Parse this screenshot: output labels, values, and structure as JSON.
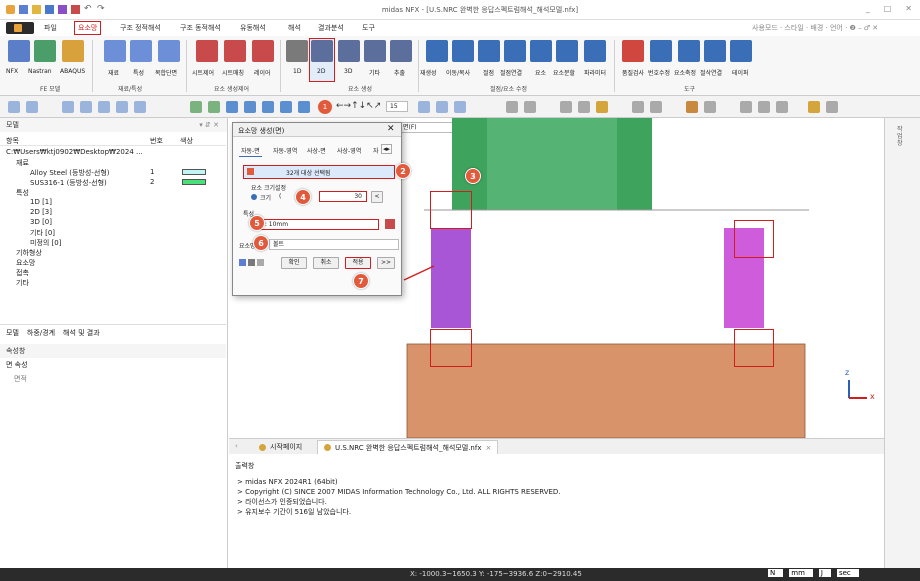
{
  "window": {
    "title": "midas NFX - [U.S.NRC 완벽한 응답스펙트럼해석_해석모델.nfx]",
    "controls": [
      "_",
      "□",
      "✕"
    ]
  },
  "menu": {
    "items": [
      "파일",
      "요소망",
      "구조 정적해석",
      "구조 동적해석",
      "유동해석",
      "해석",
      "결과분석",
      "도구"
    ],
    "active_index": 1,
    "right": "사용모드 · 스타일 · 배경 · 언어 · ❷ – ♂ ✕"
  },
  "ribbon": {
    "buttons": [
      "NFX",
      "Nastran",
      "ABAQUS",
      "재료",
      "특성",
      "복합단면",
      "시트제어",
      "시트매칭",
      "레이어",
      "1D",
      "2D",
      "3D",
      "기타",
      "추출",
      "재생성",
      "이동/복사",
      "절점",
      "절점연결",
      "요소",
      "요소분할",
      "파라미터",
      "품질검사",
      "번호수정",
      "요소축정",
      "절삭연결",
      "테이퍼"
    ],
    "groups": [
      "FE 모델",
      "재료/특성",
      "요소 생성제어",
      "요소 생성",
      "절점/요소 수정",
      "도구"
    ]
  },
  "toolbar2": {
    "zoom_value": "15"
  },
  "left_panel": {
    "model_header": "모델",
    "tree_columns": [
      "항목",
      "번호",
      "색상"
    ],
    "tree": [
      {
        "label": "C:₩Users₩ktj0902₩Desktop₩2024 ...",
        "indent": 0
      },
      {
        "label": "재료",
        "indent": 1
      },
      {
        "label": "Alloy Steel (등방성-선형)",
        "num": "1",
        "indent": 2,
        "color": "#bff5f5"
      },
      {
        "label": "SUS316-1 (등방성-선형)",
        "num": "2",
        "indent": 2,
        "color": "#49e07a"
      },
      {
        "label": "특성",
        "indent": 1
      },
      {
        "label": "1D [1]",
        "indent": 2
      },
      {
        "label": "2D [3]",
        "indent": 2
      },
      {
        "label": "3D [0]",
        "indent": 2
      },
      {
        "label": "기타 [0]",
        "indent": 2
      },
      {
        "label": "미정의 [0]",
        "indent": 2
      },
      {
        "label": "기하형상",
        "indent": 1
      },
      {
        "label": "요소망",
        "indent": 1
      },
      {
        "label": "접촉",
        "indent": 1
      },
      {
        "label": "기타",
        "indent": 1
      }
    ],
    "tabs": [
      "모델",
      "하중/경계",
      "해석 및 결과"
    ],
    "props_header": "속성창",
    "props_section": "면 속성",
    "props_row": "면적"
  },
  "dialog": {
    "title": "요소망 생성(면)",
    "tabs": [
      "자동-면",
      "자동-영역",
      "사상-면",
      "사상-영역",
      "자"
    ],
    "selection": "32개 대상 선택됨",
    "size_label": "요소 크기설정",
    "size_option": "크기",
    "size_option2": "(",
    "size_value": "30",
    "property_label": "특성",
    "property_value": "2: 10mm",
    "mesh_label": "요소망",
    "mesh_value": "볼트",
    "buttons": [
      "확인",
      "취소",
      "적용",
      ">>"
    ]
  },
  "markers": [
    "1",
    "2",
    "3",
    "4",
    "5",
    "6",
    "7"
  ],
  "viewport": {
    "toolbar_value": "면(F)",
    "axis_z": "z",
    "axis_x": "x"
  },
  "doc_tabs": [
    "시작페이지",
    "U.S.NRC 완벽한 응답스펙트럼해석_해석모델.nfx"
  ],
  "output": {
    "header": "출력창",
    "lines": [
      "> midas NFX 2024R1 (64bit)",
      "> Copyright (C) SINCE 2007 MIDAS Information Technology Co., Ltd. ALL RIGHTS RESERVED.",
      "> 라이선스가 인증되었습니다.",
      "> 유지보수 기간이 516일 남았습니다."
    ]
  },
  "status": {
    "coords": "X: -1000.3~1650.3 Y: -175~3936.6 Z:0~2910.45",
    "units": [
      "N",
      "mm",
      "J",
      "sec"
    ]
  },
  "right_strip": {
    "label": "작업창"
  },
  "colors": {
    "accent": "#d21d1d",
    "marker": "#e15a3c",
    "green": "#3da35d",
    "purple": "#a855d6",
    "copper": "#d9936a"
  }
}
